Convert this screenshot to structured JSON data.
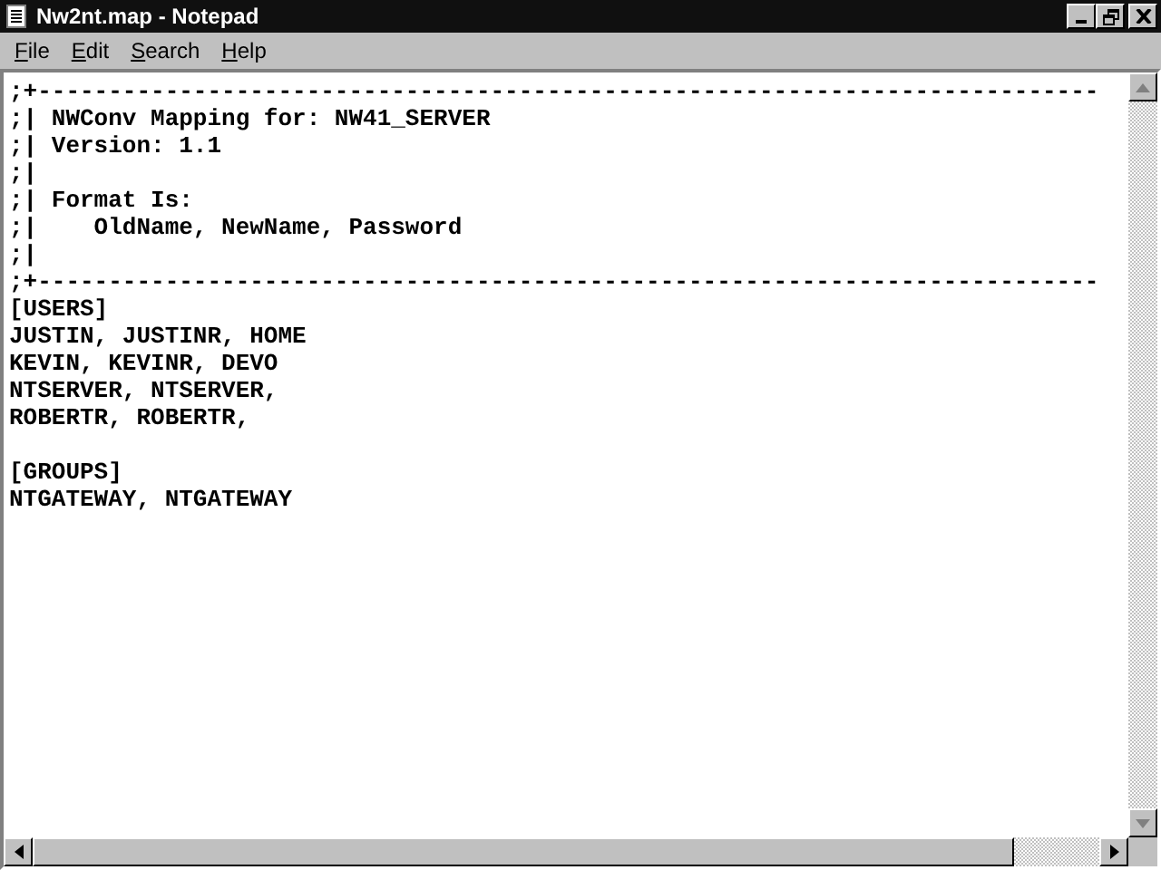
{
  "window": {
    "title": "Nw2nt.map - Notepad"
  },
  "menu": [
    {
      "label": "File"
    },
    {
      "label": "Edit"
    },
    {
      "label": "Search"
    },
    {
      "label": "Help"
    }
  ],
  "lines": [
    {
      "text": ";+---------------------------------------------------------------------------"
    },
    {
      "text": ";| NWConv Mapping for: NW41_SERVER"
    },
    {
      "text": ";| Version: 1.1"
    },
    {
      "text": ";|"
    },
    {
      "text": ";| Format Is:"
    },
    {
      "text": ";|    OldName, NewName, Password"
    },
    {
      "text": ";|"
    },
    {
      "text": ";+---------------------------------------------------------------------------"
    },
    {
      "text": "[USERS]"
    },
    {
      "text": "JUSTIN, JUSTINR, HOME"
    },
    {
      "text": "KEVIN, KEVINR, DEVO"
    },
    {
      "text": "NTSERVER, NTSERVER,"
    },
    {
      "text": "ROBERTR, ROBERTR,"
    },
    {
      "text": "[GROUPS]",
      "space_before": true
    },
    {
      "text": "NTGATEWAY, NTGATEWAY"
    }
  ]
}
